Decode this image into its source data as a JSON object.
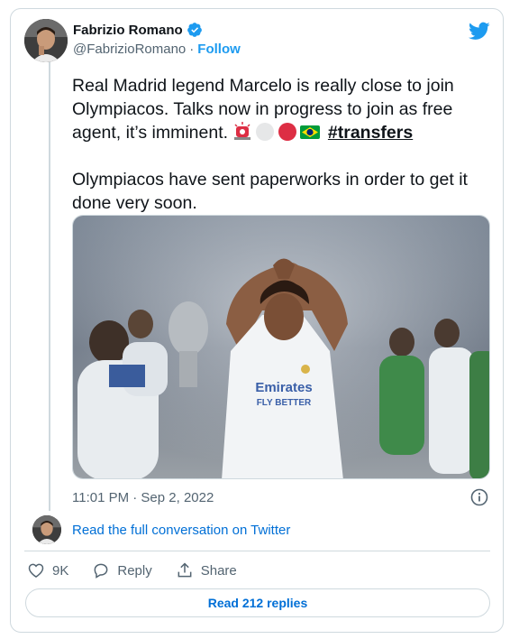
{
  "author": {
    "display_name": "Fabrizio Romano",
    "handle": "@FabrizioRomano",
    "separator": "·",
    "follow_label": "Follow"
  },
  "tweet": {
    "line1": "Real Madrid legend Marcelo is really close to join Olympiacos. Talks now in progress to join as free agent, it’s imminent.",
    "hashtag": "#transfers",
    "paragraph2": "Olympiacos have sent paperworks in order to get it done very soon.",
    "emojis": [
      "siren-emoji",
      "white-circle-emoji",
      "red-circle-emoji",
      "brazil-flag-emoji"
    ]
  },
  "meta": {
    "timestamp": "11:01 PM · Sep 2, 2022"
  },
  "conversation": {
    "link_label": "Read the full conversation on Twitter"
  },
  "actions": {
    "likes": "9K",
    "reply_label": "Reply",
    "share_label": "Share"
  },
  "replies_button": {
    "label": "Read 212 replies"
  },
  "colors": {
    "twitter_blue": "#1d9bf0",
    "link_blue": "#006fd6",
    "muted": "#536471",
    "border": "#cfd9de"
  }
}
